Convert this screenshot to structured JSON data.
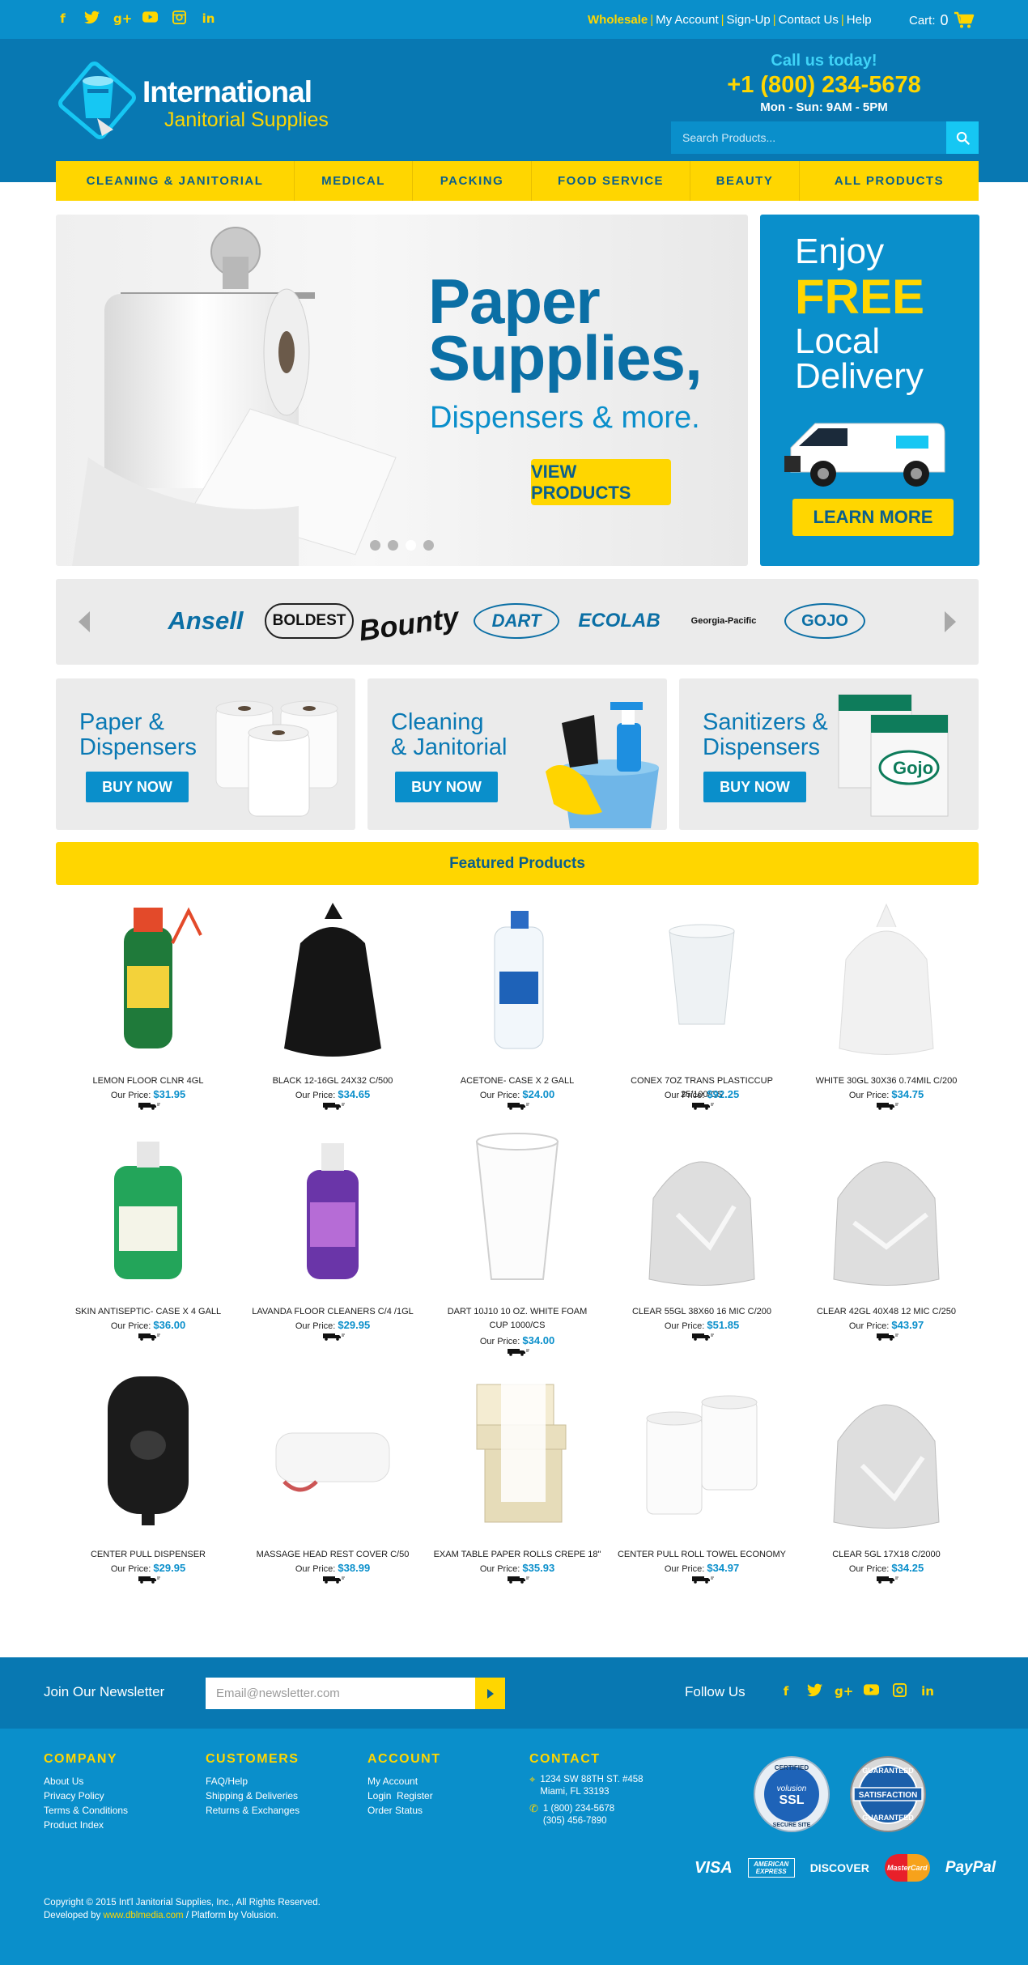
{
  "social": [
    "facebook-icon",
    "twitter-icon",
    "google-plus-icon",
    "youtube-icon",
    "instagram-icon",
    "linkedin-icon"
  ],
  "topbar": {
    "wholesale": "Wholesale",
    "links": [
      "My Account",
      "Sign-Up",
      "Contact Us",
      "Help"
    ],
    "cart_label": "Cart:",
    "cart_count": "0"
  },
  "header": {
    "logo_line1": "International",
    "logo_line2": "Janitorial Supplies",
    "call_label": "Call us today!",
    "phone": "+1 (800) 234-5678",
    "hours": "Mon - Sun: 9AM - 5PM",
    "search_placeholder": "Search Products..."
  },
  "nav": [
    "CLEANING & JANITORIAL",
    "MEDICAL",
    "PACKING",
    "FOOD SERVICE",
    "BEAUTY",
    "ALL PRODUCTS"
  ],
  "hero": {
    "title_line1": "Paper",
    "title_line2": "Supplies,",
    "subtitle": "Dispensers & more.",
    "cta": "VIEW PRODUCTS",
    "slides": 4,
    "active_slide": 3
  },
  "promo": {
    "line1": "Enjoy",
    "free": "FREE",
    "line3": "Local",
    "line4": "Delivery",
    "cta": "LEARN MORE"
  },
  "brands": [
    "Ansell",
    "BOLDEST",
    "Bounty",
    "DART",
    "ECOLAB",
    "Georgia-Pacific",
    "GOJO"
  ],
  "categories": [
    {
      "line1": "Paper &",
      "line2": "Dispensers",
      "button": "BUY NOW"
    },
    {
      "line1": "Cleaning",
      "line2": "& Janitorial",
      "button": "BUY NOW"
    },
    {
      "line1": "Sanitizers &",
      "line2": "Dispensers",
      "button": "BUY NOW"
    }
  ],
  "featured_title": "Featured Products",
  "price_label": "Our Price:",
  "products": [
    {
      "name": "LEMON FLOOR CLNR 4GL",
      "price": "$31.95"
    },
    {
      "name": "BLACK 12-16GL 24X32 C/500",
      "price": "$34.65"
    },
    {
      "name": "ACETONE- CASE X 2 GALL",
      "price": "$24.00"
    },
    {
      "name": "CONEX 7OZ TRANS PLASTICCUP 25/100/CS",
      "price": "$92.25"
    },
    {
      "name": "WHITE 30GL 30X36 0.74MIL C/200",
      "price": "$34.75"
    },
    {
      "name": "SKIN ANTISEPTIC- CASE X 4 GALL",
      "price": "$36.00"
    },
    {
      "name": "LAVANDA FLOOR CLEANERS C/4 /1GL",
      "price": "$29.95"
    },
    {
      "name": "DART 10J10 10 OZ. WHITE FOAM CUP 1000/CS",
      "price": "$34.00"
    },
    {
      "name": "CLEAR 55GL 38X60 16 MIC C/200",
      "price": "$51.85"
    },
    {
      "name": "CLEAR 42GL 40X48 12 MIC C/250",
      "price": "$43.97"
    },
    {
      "name": "CENTER PULL DISPENSER",
      "price": "$29.95"
    },
    {
      "name": "MASSAGE HEAD REST COVER C/50",
      "price": "$38.99"
    },
    {
      "name": "EXAM TABLE PAPER ROLLS CREPE 18\"",
      "price": "$35.93"
    },
    {
      "name": "CENTER PULL ROLL TOWEL ECONOMY",
      "price": "$34.97"
    },
    {
      "name": "CLEAR 5GL 17X18 C/2000",
      "price": "$34.25"
    }
  ],
  "newsletter": {
    "label": "Join Our Newsletter",
    "placeholder": "Email@newsletter.com",
    "follow": "Follow Us"
  },
  "footer": {
    "company": {
      "title": "COMPANY",
      "links": [
        "About Us",
        "Privacy Policy",
        "Terms & Conditions",
        "Product Index"
      ]
    },
    "customers": {
      "title": "CUSTOMERS",
      "links": [
        "FAQ/Help",
        "Shipping & Deliveries",
        "Returns & Exchanges"
      ]
    },
    "account": {
      "title": "ACCOUNT",
      "links": [
        "My Account",
        "Login",
        "Register",
        "Order Status"
      ]
    },
    "contact": {
      "title": "CONTACT",
      "address1": "1234 SW 88TH ST. #458",
      "address2": "Miami, FL 33193",
      "phone1": "1 (800) 234-5678",
      "phone2": "(305) 456-7890"
    },
    "seal1": {
      "top": "CERTIFIED",
      "mid": "volusion",
      "big": "SSL",
      "bottom": "SECURE SITE"
    },
    "seal2": {
      "top": "GUARANTEED",
      "mid": "SATISFACTION",
      "bottom": "GUARANTEED"
    },
    "cards": [
      "VISA",
      "AMERICAN EXPRESS",
      "DISCOVER",
      "MasterCard",
      "PayPal"
    ],
    "copyright": "Copyright © 2015 Int'l Janitorial Supplies, Inc., All Rights Reserved.",
    "developed_prefix": "Developed by",
    "developer": "www.dblmedia.com",
    "platform": "/ Platform by Volusion."
  },
  "colors": {
    "primary_blue": "#0a8fcb",
    "dark_blue": "#0878b2",
    "yellow": "#ffd600",
    "light_gray": "#ebebeb"
  }
}
